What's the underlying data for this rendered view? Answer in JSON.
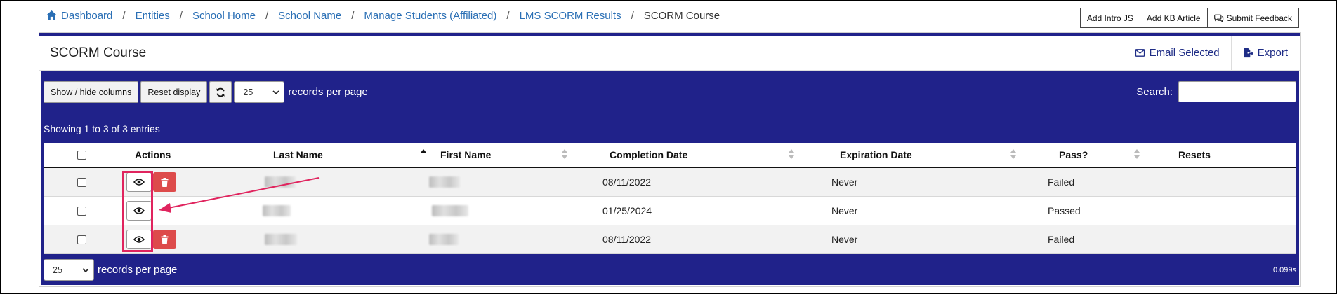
{
  "breadcrumb": [
    {
      "label": "Dashboard",
      "icon": "home-icon"
    },
    {
      "label": "Entities"
    },
    {
      "label": "School Home"
    },
    {
      "label": "School Name"
    },
    {
      "label": "Manage Students (Affiliated)"
    },
    {
      "label": "LMS SCORM Results"
    },
    {
      "label": "SCORM Course"
    }
  ],
  "breadcrumb_separator": "/",
  "top_actions": {
    "intro_js": "Add Intro JS",
    "kb_article": "Add KB Article",
    "feedback": "Submit Feedback"
  },
  "panel": {
    "title": "SCORM Course",
    "email_selected": "Email Selected",
    "export": "Export"
  },
  "controls": {
    "show_hide": "Show / hide columns",
    "reset_display": "Reset display",
    "page_size": "25",
    "records_per_page": "records per page",
    "search_label": "Search:",
    "search_value": ""
  },
  "info": "Showing 1 to 3 of 3 entries",
  "table": {
    "columns": {
      "actions": "Actions",
      "last_name": "Last Name",
      "first_name": "First Name",
      "completion_date": "Completion Date",
      "expiration_date": "Expiration Date",
      "pass": "Pass?",
      "resets": "Resets"
    },
    "rows": [
      {
        "completion_date": "08/11/2022",
        "expiration_date": "Never",
        "pass": "Failed",
        "resets": "",
        "has_delete": true
      },
      {
        "completion_date": "01/25/2024",
        "expiration_date": "Never",
        "pass": "Passed",
        "resets": "",
        "has_delete": false
      },
      {
        "completion_date": "08/11/2022",
        "expiration_date": "Never",
        "pass": "Failed",
        "resets": "",
        "has_delete": true
      }
    ]
  },
  "footer": {
    "page_size": "25",
    "records_per_page": "records per page",
    "timing": "0.099s"
  },
  "colors": {
    "brand_blue": "#20228a",
    "link_blue": "#2a6fb5",
    "delete_red": "#dd4b4b",
    "annotation": "#e0245e"
  }
}
